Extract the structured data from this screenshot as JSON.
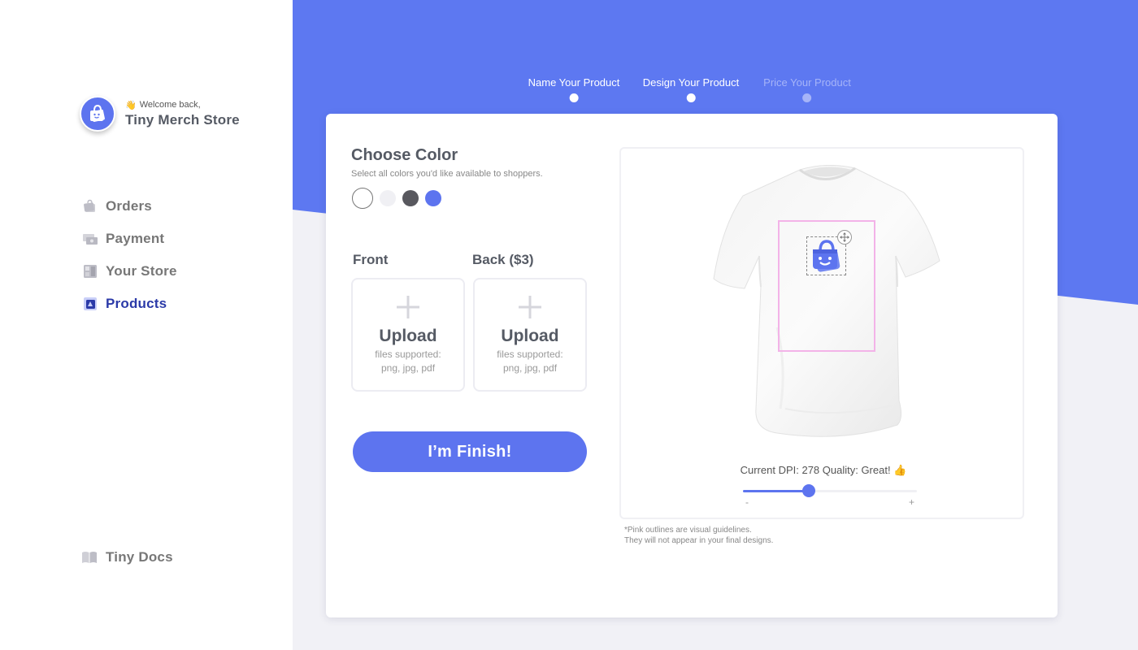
{
  "sidebar": {
    "welcome": "Welcome back,",
    "wave_emoji": "👋",
    "store_name": "Tiny Merch Store",
    "nav": [
      {
        "label": "Orders",
        "icon": "bag-icon",
        "active": false
      },
      {
        "label": "Payment",
        "icon": "money-icon",
        "active": false
      },
      {
        "label": "Your Store",
        "icon": "store-icon",
        "active": false
      },
      {
        "label": "Products",
        "icon": "products-icon",
        "active": true
      }
    ],
    "docs_label": "Tiny Docs"
  },
  "stepper": {
    "steps": [
      {
        "label": "Name Your Product",
        "state": "done"
      },
      {
        "label": "Design Your Product",
        "state": "current"
      },
      {
        "label": "Price Your Product",
        "state": "inactive"
      }
    ]
  },
  "color_picker": {
    "title": "Choose Color",
    "subtitle": "Select all colors you'd like available to shoppers.",
    "colors": [
      "#ffffff",
      "#f0f0f4",
      "#58585e",
      "#5d74ef"
    ],
    "selected_index": 0
  },
  "upload": {
    "front_label": "Front",
    "back_label": "Back ($3)",
    "title": "Upload",
    "sub_line1": "files supported:",
    "sub_line2": "png, jpg, pdf"
  },
  "finish_button": "I’m Finish!",
  "preview": {
    "dpi_text": "Current DPI: 278  Quality: Great!",
    "quality_emoji": "👍",
    "slider_min": "-",
    "slider_max": "+",
    "slider_value": 0.38,
    "note_line1": "*Pink outlines are visual guidelines.",
    "note_line2": "They will not appear in your final designs."
  },
  "colors": {
    "accent": "#5d74ef",
    "active_nav": "#2b3aa8",
    "guide": "#f3b3e8"
  }
}
